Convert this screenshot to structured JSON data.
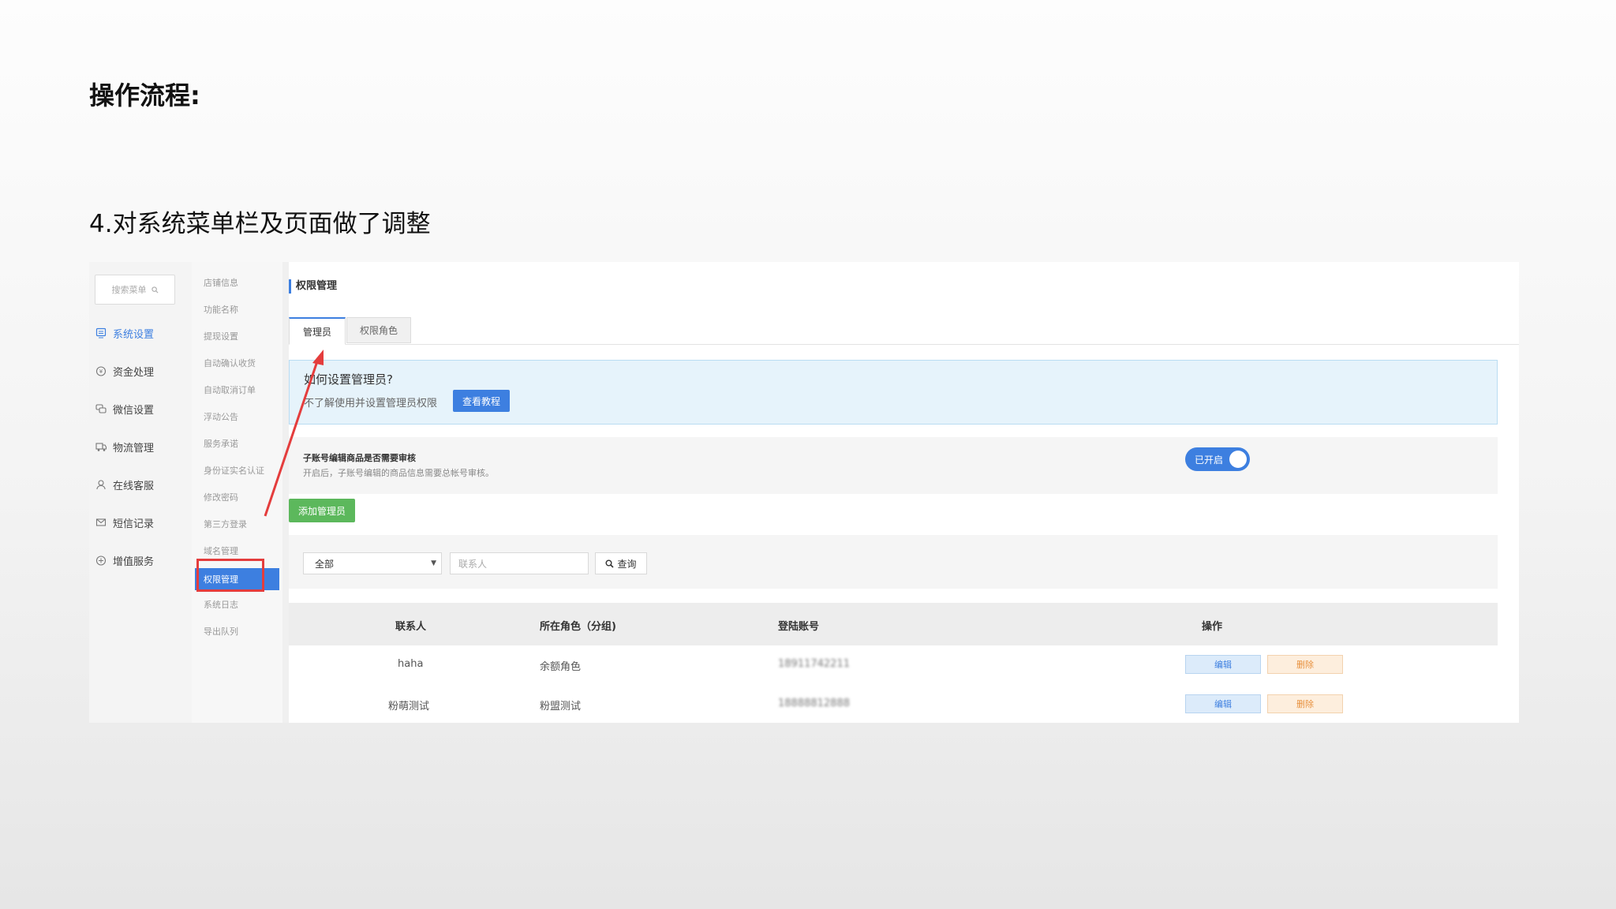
{
  "slide": {
    "heading": "操作流程:",
    "subheading": "4.对系统菜单栏及页面做了调整"
  },
  "nav": {
    "search_placeholder": "搜索菜单",
    "items": [
      {
        "label": "系统设置",
        "icon": "system-settings-icon",
        "active": true
      },
      {
        "label": "资金处理",
        "icon": "funds-icon",
        "active": false
      },
      {
        "label": "微信设置",
        "icon": "wechat-icon",
        "active": false
      },
      {
        "label": "物流管理",
        "icon": "logistics-icon",
        "active": false
      },
      {
        "label": "在线客服",
        "icon": "customer-service-icon",
        "active": false
      },
      {
        "label": "短信记录",
        "icon": "sms-icon",
        "active": false
      },
      {
        "label": "增值服务",
        "icon": "value-added-icon",
        "active": false
      }
    ]
  },
  "subnav": {
    "items": [
      "店铺信息",
      "功能名称",
      "提现设置",
      "自动确认收货",
      "自动取消订单",
      "浮动公告",
      "服务承诺",
      "身份证实名认证",
      "修改密码",
      "第三方登录",
      "域名管理",
      "权限管理",
      "系统日志",
      "导出队列"
    ],
    "active": "权限管理"
  },
  "main": {
    "title": "权限管理",
    "tabs": [
      "管理员",
      "权限角色"
    ],
    "info": {
      "title": "如何设置管理员?",
      "text": "不了解使用并设置管理员权限",
      "button": "查看教程"
    },
    "audit": {
      "title": "子账号编辑商品是否需要审核",
      "desc": "开启后，子账号编辑的商品信息需要总帐号审核。",
      "toggle_label": "已开启",
      "toggle_on": true
    },
    "add_button": "添加管理员",
    "filter": {
      "select_value": "全部",
      "contact_placeholder": "联系人",
      "search_button": "查询"
    },
    "table": {
      "headers": [
        "联系人",
        "所在角色（分组)",
        "登陆账号",
        "操作"
      ],
      "rows": [
        {
          "contact": "haha",
          "role": "余额角色",
          "account": "18911742211",
          "edit": "编辑",
          "delete": "删除"
        },
        {
          "contact": "粉萌测试",
          "role": "粉盟测试",
          "account": "18888812888",
          "edit": "编辑",
          "delete": "删除"
        }
      ]
    }
  },
  "colors": {
    "accent": "#3d7fe0",
    "highlight_box": "#e43d3d",
    "add_button": "#5cb85c",
    "arrow": "#e43d3d"
  }
}
